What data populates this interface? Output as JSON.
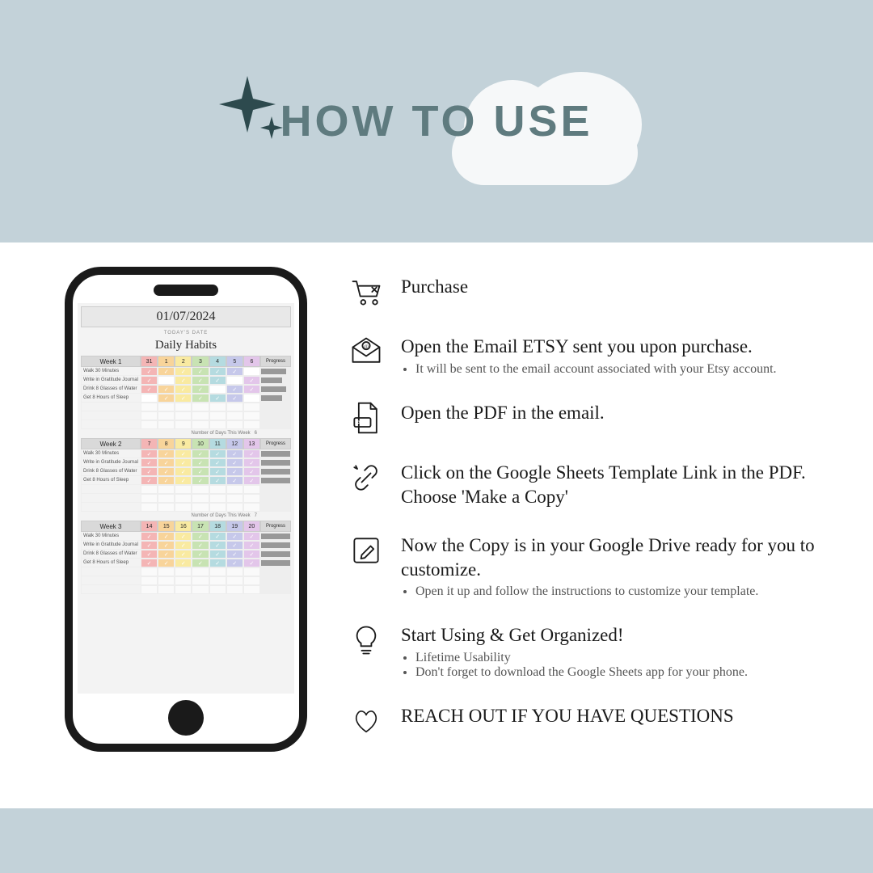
{
  "header": {
    "title": "HOW TO USE"
  },
  "phone": {
    "date": "01/07/2024",
    "date_label": "TODAY'S DATE",
    "section_title": "Daily Habits",
    "progress_label": "Progress",
    "habits": [
      "Walk 30 Minutes",
      "Write in Gratitude Journal",
      "Drink 8 Glasses of Water",
      "Get 8 Hours of Sleep"
    ],
    "day_colors": [
      "#f4b5b5",
      "#f8d49a",
      "#f9eaa1",
      "#c8e3b3",
      "#b5dbe0",
      "#c6c8ea",
      "#e3c6ea"
    ],
    "weeks": [
      {
        "label": "Week 1",
        "days": [
          "31",
          "1",
          "2",
          "3",
          "4",
          "5",
          "6"
        ],
        "checks": [
          [
            1,
            1,
            1,
            1,
            1,
            1,
            0
          ],
          [
            1,
            0,
            1,
            1,
            1,
            0,
            1
          ],
          [
            1,
            1,
            1,
            1,
            0,
            1,
            1
          ],
          [
            0,
            1,
            1,
            1,
            1,
            1,
            0
          ]
        ],
        "progress": [
          86,
          71,
          86,
          71
        ],
        "foot_label": "Number of Days This Week",
        "foot_val": "6"
      },
      {
        "label": "Week 2",
        "days": [
          "7",
          "8",
          "9",
          "10",
          "11",
          "12",
          "13"
        ],
        "checks": [
          [
            1,
            1,
            1,
            1,
            1,
            1,
            1
          ],
          [
            1,
            1,
            1,
            1,
            1,
            1,
            1
          ],
          [
            1,
            1,
            1,
            1,
            1,
            1,
            1
          ],
          [
            1,
            1,
            1,
            1,
            1,
            1,
            1
          ]
        ],
        "progress": [
          100,
          100,
          100,
          100
        ],
        "foot_label": "Number of Days This Week",
        "foot_val": "7"
      },
      {
        "label": "Week 3",
        "days": [
          "14",
          "15",
          "16",
          "17",
          "18",
          "19",
          "20"
        ],
        "checks": [
          [
            1,
            1,
            1,
            1,
            1,
            1,
            1
          ],
          [
            1,
            1,
            1,
            1,
            1,
            1,
            1
          ],
          [
            1,
            1,
            1,
            1,
            1,
            1,
            1
          ],
          [
            1,
            1,
            1,
            1,
            1,
            1,
            1
          ]
        ],
        "progress": [
          100,
          100,
          100,
          100
        ],
        "foot_label": "",
        "foot_val": ""
      }
    ]
  },
  "steps": [
    {
      "icon": "cart",
      "title": "Purchase",
      "subs": []
    },
    {
      "icon": "mail",
      "title": "Open the Email ETSY sent you upon purchase.",
      "subs": [
        "It will be sent to the email account associated with your Etsy account."
      ]
    },
    {
      "icon": "pdf",
      "title": "Open the PDF in the email.",
      "subs": []
    },
    {
      "icon": "link",
      "title": "Click on the Google Sheets Template Link in the PDF. Choose 'Make a Copy'",
      "subs": []
    },
    {
      "icon": "edit",
      "title": "Now the Copy is in your Google Drive ready for you to customize.",
      "subs": [
        "Open it up and follow the instructions to customize your template."
      ]
    },
    {
      "icon": "bulb",
      "title": "Start Using & Get Organized!",
      "subs": [
        "Lifetime Usability",
        "Don't forget to download the Google Sheets app for your phone."
      ]
    },
    {
      "icon": "heart",
      "title": "REACH OUT IF YOU HAVE QUESTIONS",
      "subs": []
    }
  ]
}
